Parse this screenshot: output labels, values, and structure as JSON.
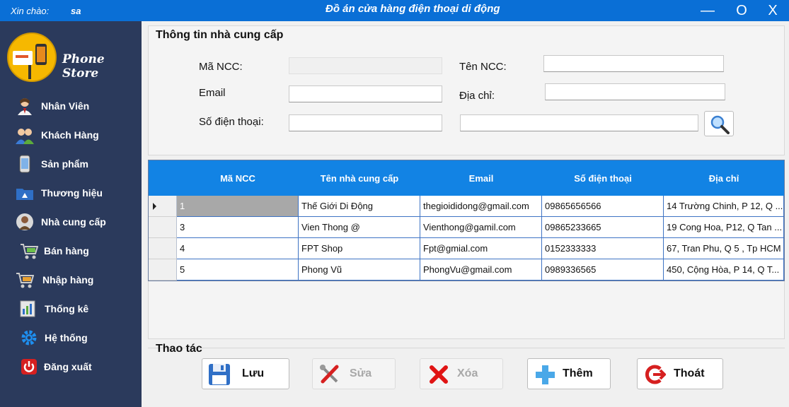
{
  "titlebar": {
    "greeting": "Xin chào:",
    "user": "sa",
    "title": "Đồ án cửa hàng điện thoại di động",
    "minimize": "—",
    "maximize": "O",
    "close": "X"
  },
  "sidebar": {
    "brand": "Phone Store",
    "items": [
      {
        "label": "Nhân Viên",
        "icon": "employee-icon"
      },
      {
        "label": "Khách Hàng",
        "icon": "customers-icon"
      },
      {
        "label": "Sản phẩm",
        "icon": "phone-icon"
      },
      {
        "label": "Thương hiệu",
        "icon": "folder-icon"
      },
      {
        "label": "Nhà cung cấp",
        "icon": "supplier-icon"
      },
      {
        "label": "Bán hàng",
        "icon": "cart-sell-icon"
      },
      {
        "label": "Nhập hàng",
        "icon": "cart-import-icon"
      },
      {
        "label": "Thống kê",
        "icon": "statistics-icon"
      },
      {
        "label": "Hệ thống",
        "icon": "gear-icon"
      },
      {
        "label": "Đăng xuất",
        "icon": "power-icon"
      }
    ]
  },
  "form": {
    "title": "Thông tin nhà cung cấp",
    "ma_ncc_label": "Mã NCC:",
    "ten_ncc_label": "Tên NCC:",
    "email_label": "Email",
    "dia_chi_label": "Địa chỉ:",
    "sdt_label": "Số điện thoại:",
    "ma_ncc_value": "",
    "ten_ncc_value": "",
    "email_value": "",
    "dia_chi_value": "",
    "sdt_value": "",
    "search_value": ""
  },
  "table": {
    "columns": [
      "Mã NCC",
      "Tên nhà cung cấp",
      "Email",
      "Số điện thoại",
      "Địa chỉ"
    ],
    "rows": [
      [
        "1",
        "Thế Giới Di Động",
        "thegioididong@gmail.com",
        "09865656566",
        "14 Trường Chinh, P 12, Q ..."
      ],
      [
        "3",
        "Vien Thong @",
        "Vienthong@gamil.com",
        "09865233665",
        "19 Cong Hoa, P12, Q Tan ..."
      ],
      [
        "4",
        "FPT Shop",
        "Fpt@gmial.com",
        "0152333333",
        "67, Tran Phu, Q 5 , Tp HCM"
      ],
      [
        "5",
        "Phong Vũ",
        "PhongVu@gmail.com",
        "0989336565",
        "450, Cộng Hòa, P 14, Q T..."
      ]
    ]
  },
  "actions": {
    "title": "Thao tác",
    "buttons": [
      {
        "label": "Lưu",
        "enabled": true,
        "icon": "save-icon"
      },
      {
        "label": "Sửa",
        "enabled": false,
        "icon": "tools-icon"
      },
      {
        "label": "Xóa",
        "enabled": false,
        "icon": "delete-icon"
      },
      {
        "label": "Thêm",
        "enabled": true,
        "icon": "add-icon"
      },
      {
        "label": "Thoát",
        "enabled": true,
        "icon": "exit-icon"
      }
    ]
  },
  "colors": {
    "titlebar": "#0a6fd6",
    "sidebar": "#2b3a5c",
    "header": "#1283e4"
  }
}
